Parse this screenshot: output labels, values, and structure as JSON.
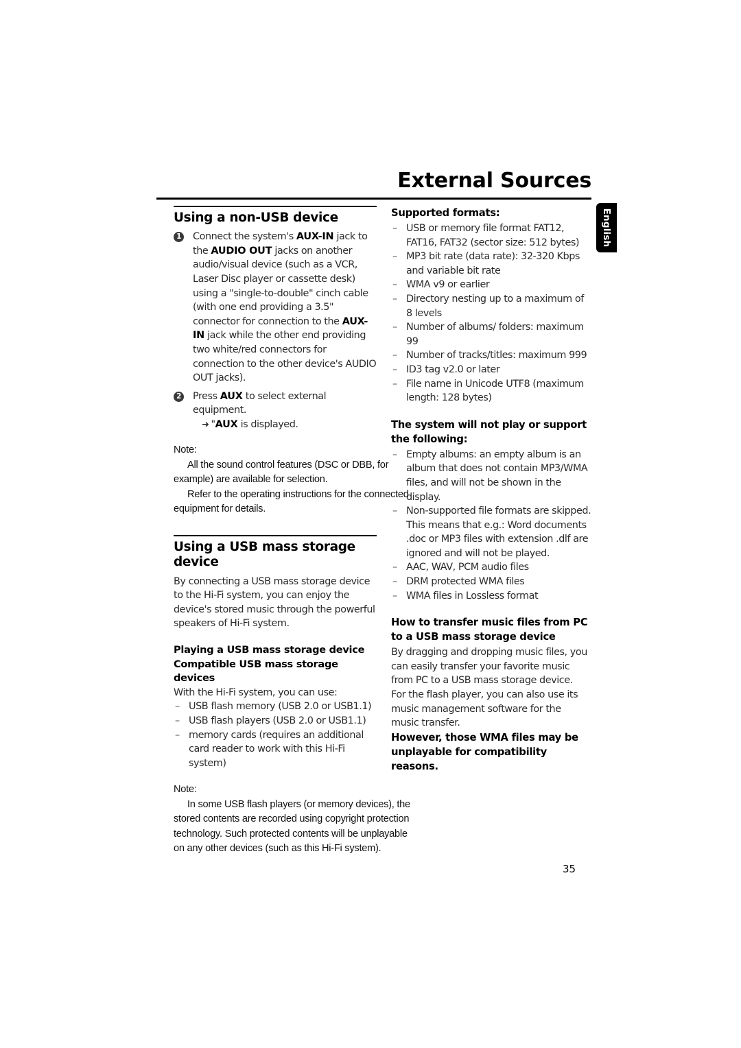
{
  "header": {
    "title": "External Sources",
    "language_tab": "English",
    "page_number": "35"
  },
  "left_column": {
    "section1": {
      "heading": "Using a non-USB device",
      "steps": [
        {
          "num": "1",
          "parts": [
            {
              "t": "Connect the system's ",
              "b": false
            },
            {
              "t": "AUX-IN",
              "b": true
            },
            {
              "t": " jack to the ",
              "b": false
            },
            {
              "t": "AUDIO OUT",
              "b": true
            },
            {
              "t": " jacks on another audio/visual device (such as a VCR, Laser Disc player or cassette desk) using a \"single-to-double\" cinch cable (with one end providing a 3.5\" connector for connection to the ",
              "b": false
            },
            {
              "t": "AUX-IN",
              "b": true
            },
            {
              "t": " jack while the other end providing two white/red connectors for connection to the other device's AUDIO OUT jacks).",
              "b": false
            }
          ]
        },
        {
          "num": "2",
          "parts": [
            {
              "t": "Press ",
              "b": false
            },
            {
              "t": "AUX",
              "b": true
            },
            {
              "t": " to select external equipment.",
              "b": false
            }
          ],
          "sub_arrow": {
            "arrow": "➜",
            "parts": [
              {
                "t": "\"",
                "b": false
              },
              {
                "t": "AUX",
                "b": true
              },
              {
                "t": " is displayed.",
                "b": false
              }
            ]
          }
        }
      ]
    },
    "note1": {
      "label": "Note:",
      "paragraphs": [
        "All the sound control features (DSC or DBB, for example) are available for selection.",
        "Refer to the operating instructions for the connected equipment for details."
      ]
    },
    "section2": {
      "heading": "Using a USB mass storage device",
      "intro": "By connecting a USB mass storage device to the Hi-Fi system, you can enjoy the device's stored music through the powerful speakers of Hi-Fi system."
    },
    "subsection": {
      "heading_line1_parts": [
        {
          "t": "Playing a ",
          "b": true
        },
        {
          "t": "USB",
          "b": true
        },
        {
          "t": " mass storage device",
          "b": true
        }
      ],
      "heading_line1": "Playing a USB mass storage device",
      "heading_line2": "Compatible USB mass storage devices",
      "lead": "With the Hi-Fi system, you can use:",
      "items": [
        "USB flash memory (USB 2.0 or USB1.1)",
        "USB flash players (USB 2.0 or USB1.1)",
        "memory cards (requires an additional card reader to work with this Hi-Fi system)"
      ]
    },
    "note2": {
      "label": "Note:",
      "paragraphs": [
        "In some USB flash players (or memory devices), the stored contents are recorded using copyright protection technology. Such protected contents will be unplayable on any other devices (such as this Hi-Fi system)."
      ]
    }
  },
  "right_column": {
    "supported": {
      "heading": "Supported formats:",
      "items": [
        "USB or memory file format FAT12, FAT16, FAT32 (sector size: 512 bytes)",
        "MP3 bit rate (data rate): 32-320 Kbps and variable bit rate",
        "WMA v9 or earlier",
        "Directory nesting up to a maximum of 8 levels",
        "Number of albums/ folders: maximum 99",
        "Number of tracks/titles: maximum 999",
        "ID3 tag v2.0 or later",
        "File name in Unicode UTF8 (maximum length: 128 bytes)"
      ]
    },
    "not_supported": {
      "heading": "The system will not play or support the following:",
      "items": [
        "Empty albums: an empty album is an album that does not contain MP3/WMA files, and will not be shown in the display.",
        "Non-supported file formats are skipped. This means that e.g.: Word documents .doc or MP3 files with extension .dlf are ignored and will not be played.",
        "AAC, WAV, PCM audio files",
        "DRM protected WMA files",
        "WMA files in Lossless format"
      ]
    },
    "transfer": {
      "heading": "How to transfer music files from PC to a USB mass storage device",
      "paragraphs": [
        "By dragging and dropping music files, you can easily transfer your favorite music from PC to a USB mass storage device.",
        "For the flash player, you can also use its music management software for the music transfer."
      ],
      "bold_note": "However, those WMA files may be unplayable for compatibility reasons."
    }
  }
}
